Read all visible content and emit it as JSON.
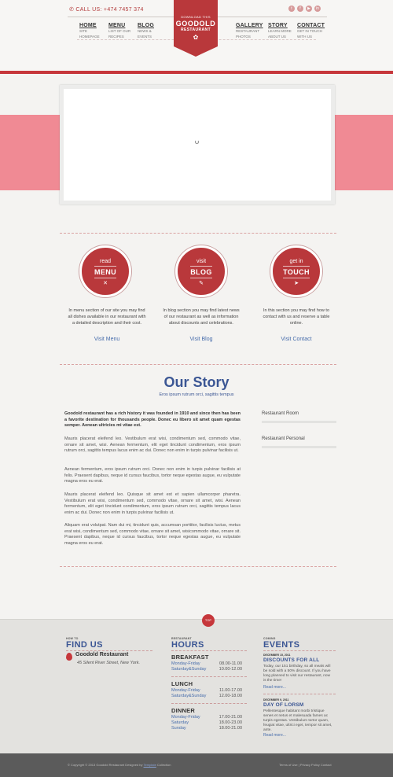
{
  "header": {
    "phone": "CALL US: +474 7457 374",
    "social_icons": [
      "twitter-icon",
      "facebook-icon",
      "youtube-icon",
      "linkedin-icon"
    ],
    "logo": {
      "small": "DOWNLOAD THIS",
      "big": "GOODOLD",
      "sub": "RESTAURANT"
    },
    "nav": [
      {
        "title": "HOME",
        "sub1": "SITE",
        "sub2": "HOMEPAGE"
      },
      {
        "title": "MENU",
        "sub1": "LIST OF OUR",
        "sub2": "RECIPES"
      },
      {
        "title": "BLOG",
        "sub1": "NEWS &",
        "sub2": "EVENTS"
      },
      {
        "title": "GALLERY",
        "sub1": "RESTAURANT",
        "sub2": "PHOTOS"
      },
      {
        "title": "STORY",
        "sub1": "LEARN MORE",
        "sub2": "ABOUT US"
      },
      {
        "title": "CONTACT",
        "sub1": "GET IN TOUCH",
        "sub2": "WITH US"
      }
    ]
  },
  "services": [
    {
      "top": "read",
      "big": "MENU",
      "icon": "fork-knife-icon",
      "text": "In menu section of our site you may find all dishes available in our restaurant with a detailed description and their cost.",
      "link": "Visit Menu"
    },
    {
      "top": "visit",
      "big": "BLOG",
      "icon": "pencil-icon",
      "text": "In blog section you may find latest news of our restaurant as well as information about discounts and celebrations.",
      "link": "Visit Blog"
    },
    {
      "top": "get in",
      "big": "TOUCH",
      "icon": "paper-plane-icon",
      "text": "In this section you may find how to contact with us and reserve a table online.",
      "link": "Visit Contact"
    }
  ],
  "story": {
    "title": "Our Story",
    "subtitle": "Eros ipsum rutrum orci, sagittis tempus",
    "lead": "Goodold restaurant has a rich history it was founded in 1910 and since then has been a favorite destination for thousands people. Donec eu libero sit amet quam egestas semper. Aenean ultricies mi vitae est.",
    "paragraphs": [
      "Mauris placerat eleifend leo. Vestibulum erat wisi, condimentum sed, commodo vitae, ornare sit amet, wisi. Aenean fermentum, elit eget tincidunt condimentum, eros ipsum rutrum orci, sagittis tempus lacus enim ac dui. Donec non enim in turpis pulvinar facilisis ut.",
      "Aenean fermentum, eros ipsum rutrum orci. Donec non enim in turpis pulvinar facilisis at felis. Praesent dapibus, neque id cursus faucibus, tortor neque egestas augue, eu vulputate magna eros eu erat.",
      "Mauris placerat eleifend leo. Quisque sit amet est et sapien ullamcorper pharetra. Vestibulum erat wisi, condimentum sed, commodo vitae, ornare sit amet, wisi. Aenean fermentum, elit eget tincidunt condimentum, eros ipsum rutrum orci, sagittis tempus lacus enim ac dui. Donec non enim in turpis pulvinar facilisis ut.",
      "Aliquam erat volutpat. Nam dui mi, tincidunt quis, accumsan porttitor, facilisis luctus, metus erat wisi, condimentum sed, commodo vitae, ornare sit amet, wisicommodo vitae, ornare sit. Praesent dapibus, neque id cursus faucibus, tortor neque egestas augue, eu vulputate magna eros eu erat."
    ],
    "side_tabs": [
      "Restaurant Room",
      "Restaurant Personal"
    ]
  },
  "footer": {
    "top_badge": "TOP",
    "find": {
      "small": "HOW TO",
      "title": "FIND US",
      "name": "Goodold Restaurant",
      "address": "45 Silent River Street, New York."
    },
    "hours": {
      "small": "RESTAURANT",
      "title": "HOURS",
      "groups": [
        {
          "name": "BREAKFAST",
          "rows": [
            {
              "days": "Monday-Friday",
              "time": "08.00-11.00"
            },
            {
              "days": "Saturday&Sunday",
              "time": "10.00-12.00"
            }
          ]
        },
        {
          "name": "LUNCH",
          "rows": [
            {
              "days": "Monday-Friday",
              "time": "11.00-17.00"
            },
            {
              "days": "Saturday&Sunday",
              "time": "12.00-18.00"
            }
          ]
        },
        {
          "name": "DINNER",
          "rows": [
            {
              "days": "Monday-Friday",
              "time": "17.00-21.00"
            },
            {
              "days": "Saturday",
              "time": "18.00-23.00"
            },
            {
              "days": "Sunday",
              "time": "18.00-21.00"
            }
          ]
        }
      ]
    },
    "events": {
      "small": "COMING",
      "title": "EVENTS",
      "items": [
        {
          "date": "DECEMBER 15, 2011",
          "title": "DISCOUNTS FOR ALL",
          "text": "Today, our 151 birthday, so all meals will be sold with a 50% discount. If you have long planned to visit our restaurant, now is the time!",
          "more": "Read more..."
        },
        {
          "date": "DECEMBER 9, 2011",
          "title": "DAY OF LORSM",
          "text": "Pellentesque habitant morbi tristique senes et netus et malesuada fames ac turpis egestas. Vestibulum tortor quam, feugiat vitae, ultrici eget, tempor sit amet, ante.",
          "more": "Read more..."
        }
      ]
    },
    "copyright_pre": "© Copyright © 2013 Goodold Restaurant Designed by",
    "copyright_link": "Template",
    "copyright_post": "Collection",
    "terms": "Terms of Use | Privacy Policy Contact"
  }
}
